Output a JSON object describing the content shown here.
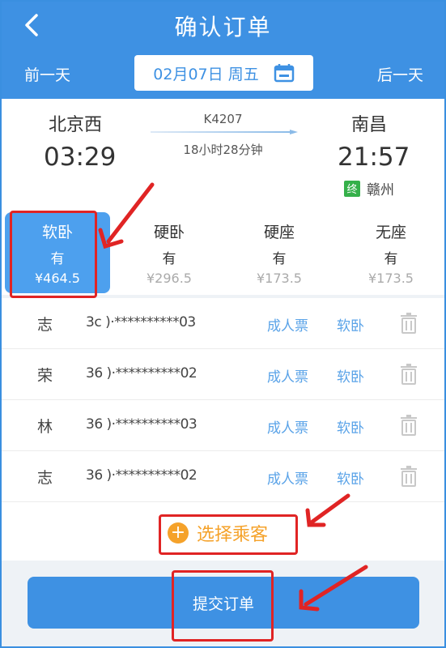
{
  "header": {
    "title": "确认订单",
    "prev_day": "前一天",
    "next_day": "后一天",
    "date": "02月07日 周五"
  },
  "train": {
    "from_station": "北京西",
    "to_station": "南昌",
    "departure_time": "03:29",
    "arrival_time": "21:57",
    "train_no": "K4207",
    "duration": "18小时28分钟",
    "terminal_badge": "终",
    "terminal_station": "赣州"
  },
  "seats": [
    {
      "name": "软卧",
      "availability": "有",
      "price": "¥464.5",
      "selected": true
    },
    {
      "name": "硬卧",
      "availability": "有",
      "price": "¥296.5",
      "selected": false
    },
    {
      "name": "硬座",
      "availability": "有",
      "price": "¥173.5",
      "selected": false
    },
    {
      "name": "无座",
      "availability": "有",
      "price": "¥173.5",
      "selected": false
    }
  ],
  "passengers": [
    {
      "name": "志",
      "id": "3c )·**********03",
      "ticket_type": "成人票",
      "seat": "软卧"
    },
    {
      "name": "荣",
      "id": "36 )·**********02",
      "ticket_type": "成人票",
      "seat": "软卧"
    },
    {
      "name": "林",
      "id": "36 )·**********03",
      "ticket_type": "成人票",
      "seat": "软卧"
    },
    {
      "name": "志",
      "id": "36 )·**********02",
      "ticket_type": "成人票",
      "seat": "软卧"
    }
  ],
  "select_passenger": "选择乘客",
  "submit": "提交订单",
  "colors": {
    "primary": "#3e91e3",
    "accent_orange": "#f5a22a",
    "annotation_red": "#e02424",
    "terminal_green": "#35b04a"
  }
}
